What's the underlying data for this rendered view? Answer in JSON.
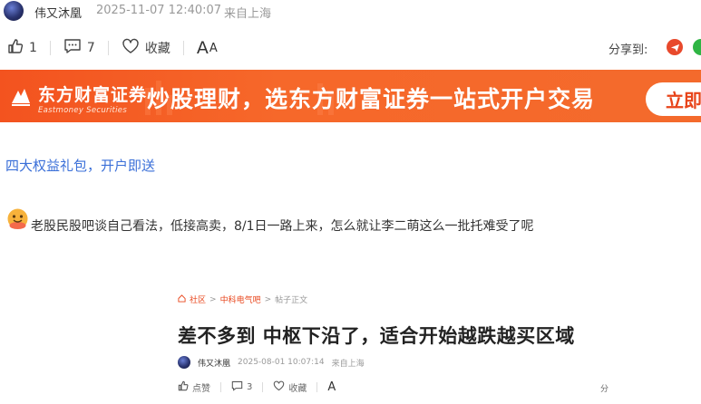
{
  "header": {
    "author": "伟又沐凰",
    "timestamp": "2025-11-07 12:40:07",
    "location": "来自上海"
  },
  "toolbar": {
    "like_count": "1",
    "comment_count": "7",
    "favorite_label": "收藏",
    "font_label_big": "A",
    "font_label_small": "A",
    "share_label": "分享到:"
  },
  "banner": {
    "logo_main": "东方财富证券",
    "logo_sub": "Eastmoney Securities",
    "slogan": "炒股理财，选东方财富证券一站式开户交易",
    "button_label": "立即"
  },
  "promo_link": "四大权益礼包，开户即送",
  "post": {
    "text": "老股民股吧谈自己看法，低接高卖，8/1日一路上来，怎么就让李二萌这么一批托难受了呢"
  },
  "embedded": {
    "breadcrumb": [
      "社区",
      "中科电气吧",
      "帖子正文"
    ],
    "title": "差不多到 中枢下沿了，适合开始越跌越买区域",
    "author": "伟又沐凰",
    "timestamp": "2025-08-01 10:07:14",
    "location": "来自上海",
    "like_label": "点赞",
    "comment_count": "3",
    "favorite_label": "收藏",
    "font_label": "A",
    "share_label": "分"
  },
  "colors": {
    "brand_orange": "#f3531f",
    "link_blue": "#3a6fd8"
  }
}
